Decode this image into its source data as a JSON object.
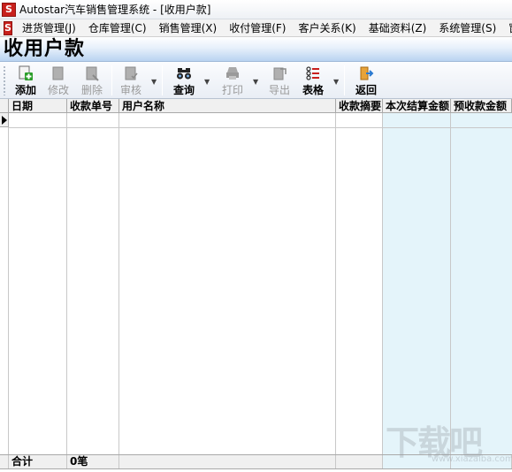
{
  "window": {
    "title": "Autostar汽车销售管理系统 - [收用户款]"
  },
  "menu": {
    "items": [
      "进货管理(J)",
      "仓库管理(C)",
      "销售管理(X)",
      "收付管理(F)",
      "客户关系(K)",
      "基础资料(Z)",
      "系统管理(S)",
      "窗"
    ]
  },
  "page": {
    "title": "收用户款"
  },
  "toolbar": {
    "add": "添加",
    "edit": "修改",
    "delete": "删除",
    "audit": "审核",
    "query": "查询",
    "print": "打印",
    "export": "导出",
    "table": "表格",
    "back": "返回"
  },
  "grid": {
    "columns": [
      "日期",
      "收款单号",
      "用户名称",
      "收款摘要",
      "本次结算金额",
      "预收款金额"
    ],
    "footer": {
      "total_label": "合计",
      "count": "0笔"
    }
  },
  "watermark": {
    "text": "下载吧",
    "url": "www.xiazaiba.com"
  },
  "colors": {
    "banner": "#b9d3f1",
    "shaded_column": "#e4f4fa",
    "icon_red": "#c8201c",
    "add_green": "#2a9d2a"
  }
}
